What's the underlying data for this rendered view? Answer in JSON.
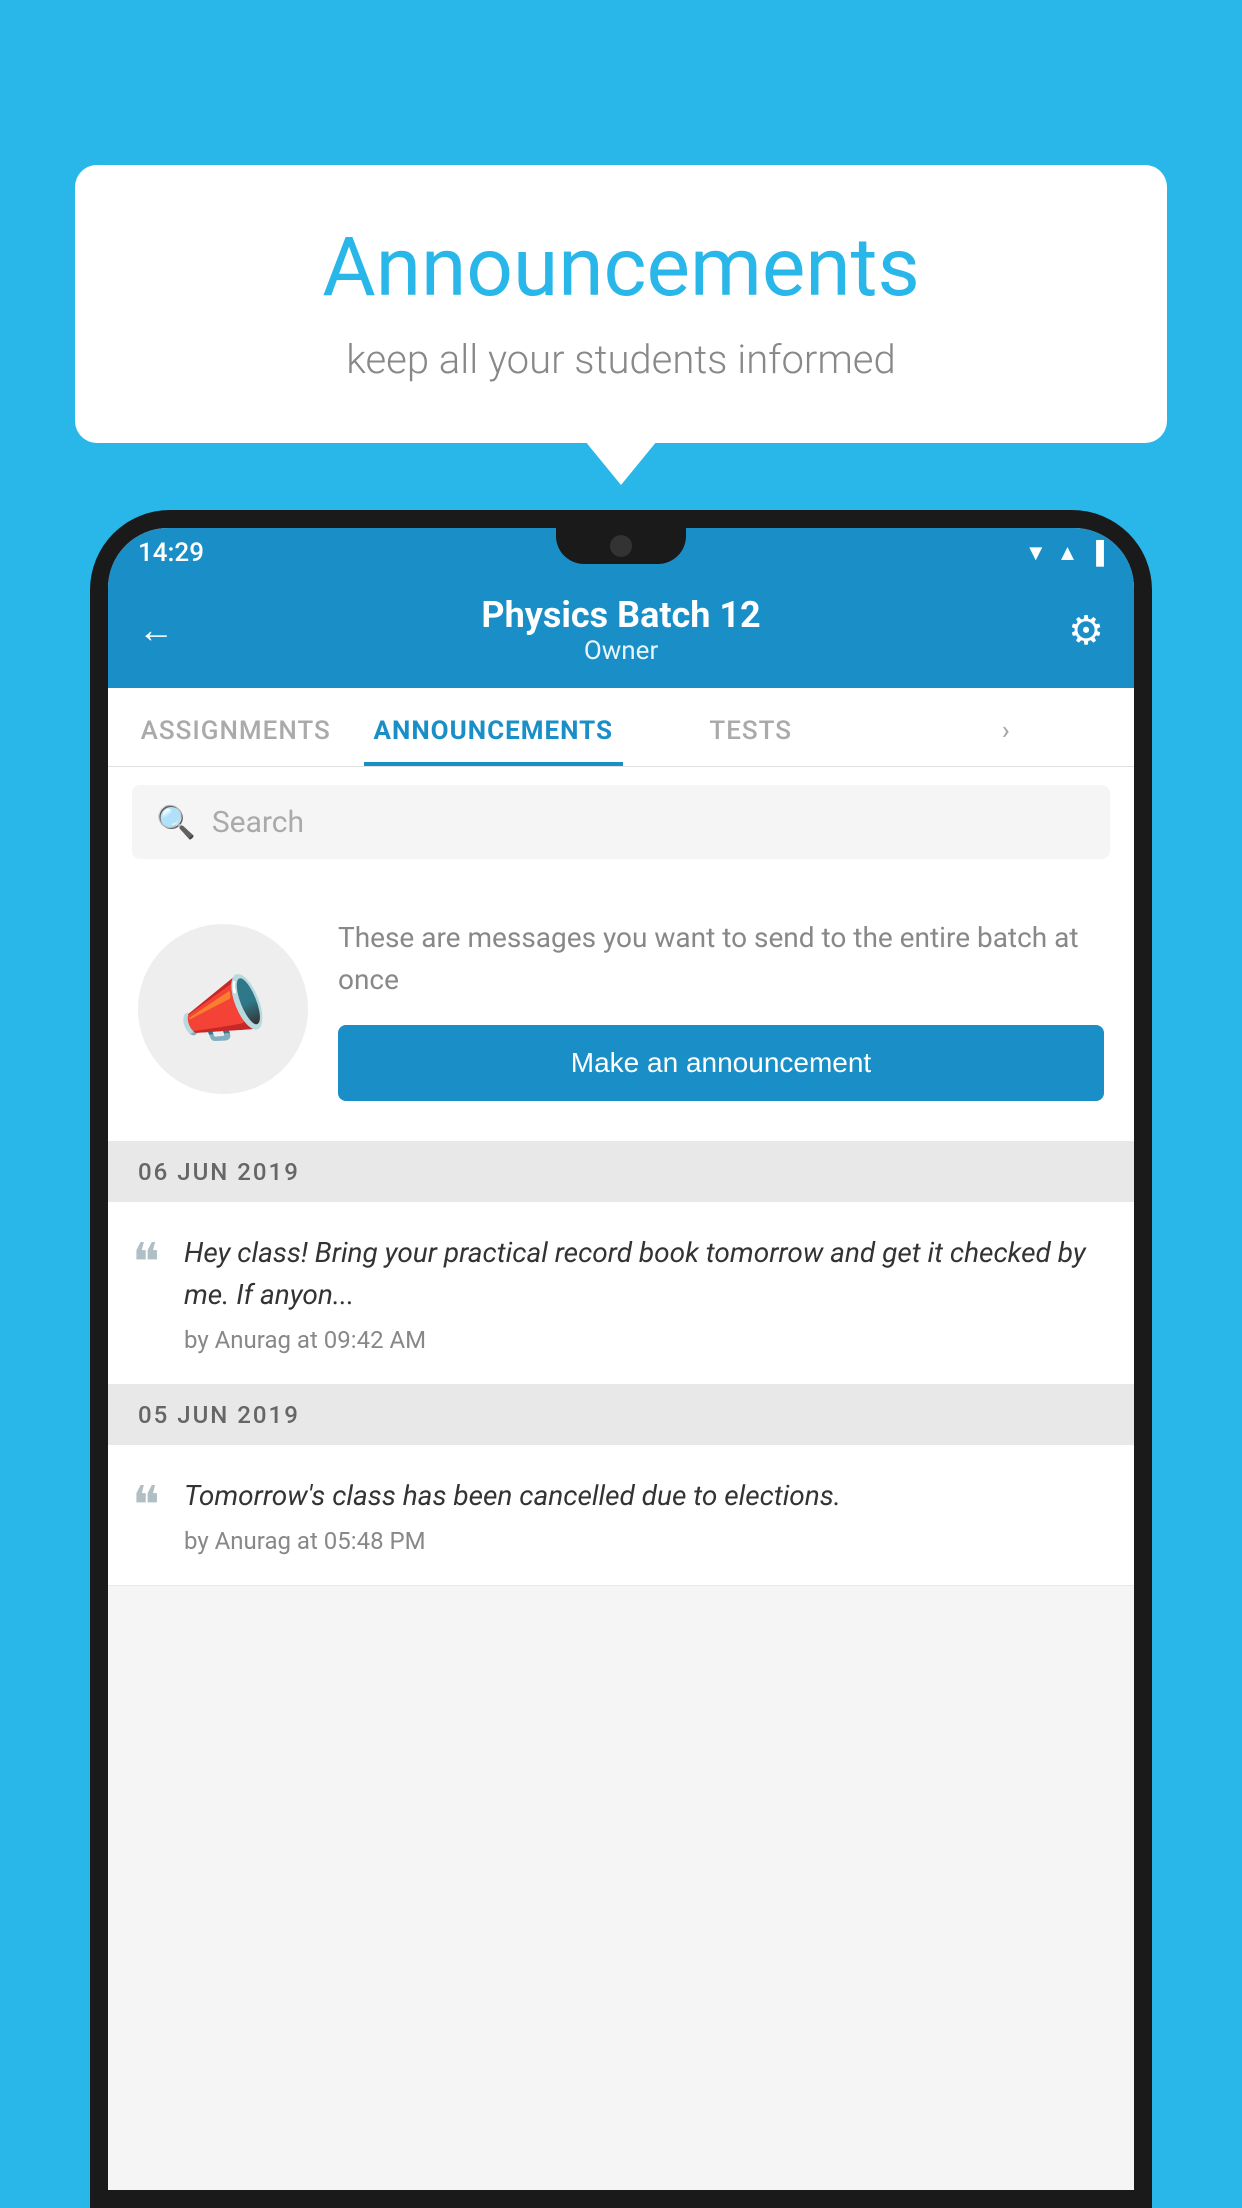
{
  "background_color": "#29b6e8",
  "speech_bubble": {
    "title": "Announcements",
    "subtitle": "keep all your students informed"
  },
  "phone": {
    "status_bar": {
      "time": "14:29",
      "icons": [
        "▼",
        "▲",
        "▐"
      ]
    },
    "header": {
      "title": "Physics Batch 12",
      "subtitle": "Owner",
      "back_label": "←",
      "gear_label": "⚙"
    },
    "tabs": [
      {
        "label": "ASSIGNMENTS",
        "active": false
      },
      {
        "label": "ANNOUNCEMENTS",
        "active": true
      },
      {
        "label": "TESTS",
        "active": false
      },
      {
        "label": "...",
        "active": false
      }
    ],
    "search": {
      "placeholder": "Search",
      "icon": "🔍"
    },
    "announcement_prompt": {
      "description_text": "These are messages you want to send to the entire batch at once",
      "button_label": "Make an announcement"
    },
    "announcements": [
      {
        "date": "06  JUN  2019",
        "text": "Hey class! Bring your practical record book tomorrow and get it checked by me. If anyon...",
        "meta": "by Anurag at 09:42 AM"
      },
      {
        "date": "05  JUN  2019",
        "text": "Tomorrow's class has been cancelled due to elections.",
        "meta": "by Anurag at 05:48 PM"
      }
    ]
  }
}
